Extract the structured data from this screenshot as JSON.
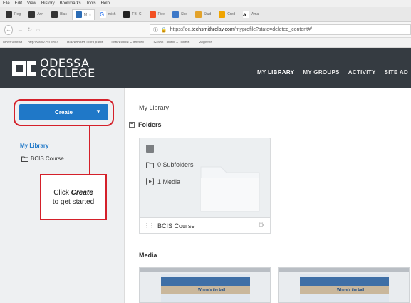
{
  "browser": {
    "menu": [
      "File",
      "Edit",
      "View",
      "History",
      "Bookmarks",
      "Tools",
      "Help"
    ],
    "tabs": [
      "Reg",
      "Ann",
      "Blac",
      "M",
      "mich",
      "FBI-C",
      "Five",
      "Sho",
      "Stud",
      "Cred",
      "Ama"
    ],
    "url_prefix": "https://oc.",
    "url_host": "techsmithrelay.com",
    "url_path": "/myprofile?state=deleted_content#/",
    "bookmarks": [
      "Most Visited",
      "http://www.csi.edu/i...",
      "Blackboard Test Quest...",
      "OfficeWise Furniture ...",
      "Grade Center – Trainin...",
      "Register"
    ]
  },
  "header": {
    "logo_line1": "ODESSA",
    "logo_line2": "COLLEGE",
    "nav": [
      "MY LIBRARY",
      "MY GROUPS",
      "ACTIVITY",
      "SITE AD"
    ]
  },
  "sidebar": {
    "create_label": "Create",
    "my_library": "My Library",
    "course": "BCIS Course"
  },
  "callout": {
    "prefix": "Click ",
    "emph": "Create",
    "suffix": " to get started"
  },
  "main": {
    "breadcrumb": "My Library",
    "folders_label": "Folders",
    "folder": {
      "subfolders": "0 Subfolders",
      "media": "1 Media",
      "name": "BCIS Course"
    },
    "media_label": "Media",
    "thumb_caption": "Where's the ball"
  },
  "colors": {
    "header_bg": "#353b41",
    "accent_blue": "#1f78c8",
    "annotation_red": "#d4202a"
  }
}
